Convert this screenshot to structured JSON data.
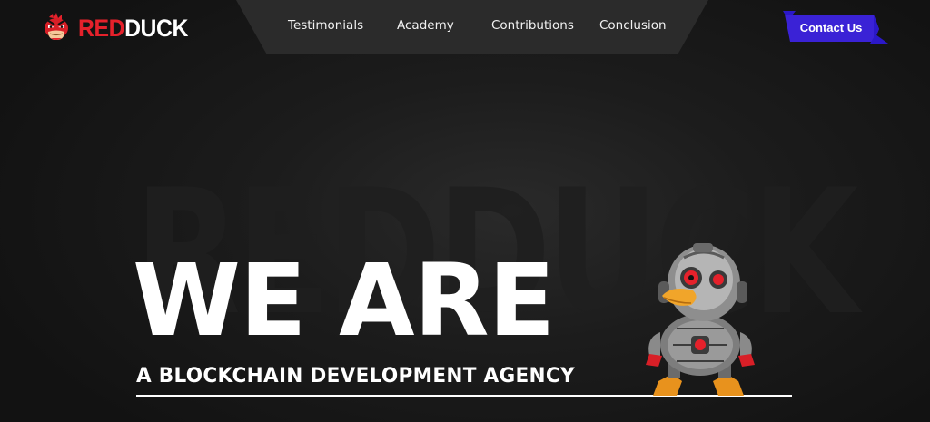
{
  "brand": {
    "name_part1": "RED",
    "name_part2": "DUCK",
    "logo_icon": "angry-duck-icon",
    "colors": {
      "red": "#e5212b",
      "white": "#ffffff"
    }
  },
  "nav": {
    "items": [
      {
        "label": "Testimonials"
      },
      {
        "label": "Academy"
      },
      {
        "label": "Contributions"
      },
      {
        "label": "Conclusion"
      }
    ],
    "background": "#2b2b2b"
  },
  "cta": {
    "label": "Contact Us",
    "color": "#3a22d6"
  },
  "hero": {
    "watermark": "REDDUCK",
    "headline": "WE ARE",
    "subheadline": "A BLOCKCHAIN DEVELOPMENT AGENCY",
    "mascot": "robot-duck-mascot"
  },
  "colors": {
    "background": "#141414"
  }
}
